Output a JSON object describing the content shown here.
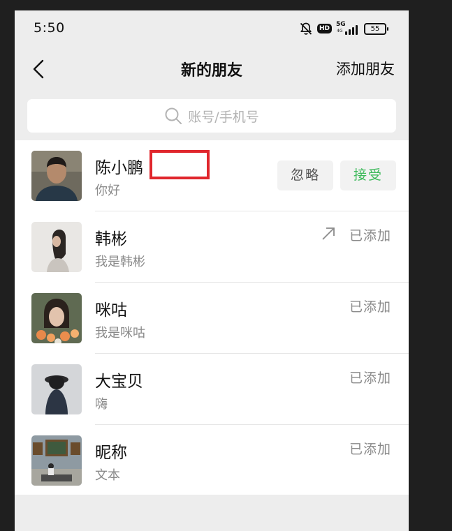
{
  "status_bar": {
    "time": "5:50",
    "network_label": "5G",
    "sub_network_label": "4G",
    "hd_label": "HD",
    "battery": "55"
  },
  "header": {
    "title": "新的朋友",
    "add_friend_label": "添加朋友"
  },
  "search": {
    "placeholder": "账号/手机号"
  },
  "requests": [
    {
      "name": "陈小鹏",
      "message": "你好",
      "ignore_label": "忽略",
      "accept_label": "接受"
    },
    {
      "name": "韩彬",
      "message": "我是韩彬",
      "status": "已添加"
    },
    {
      "name": "咪咕",
      "message": "我是咪咕",
      "status": "已添加"
    },
    {
      "name": "大宝贝",
      "message": "嗨",
      "status": "已添加"
    },
    {
      "name": "昵称",
      "message": "文本",
      "status": "已添加"
    }
  ],
  "colors": {
    "accept": "#3cb95a",
    "highlight_box": "#e0262c",
    "background": "#ededed"
  }
}
